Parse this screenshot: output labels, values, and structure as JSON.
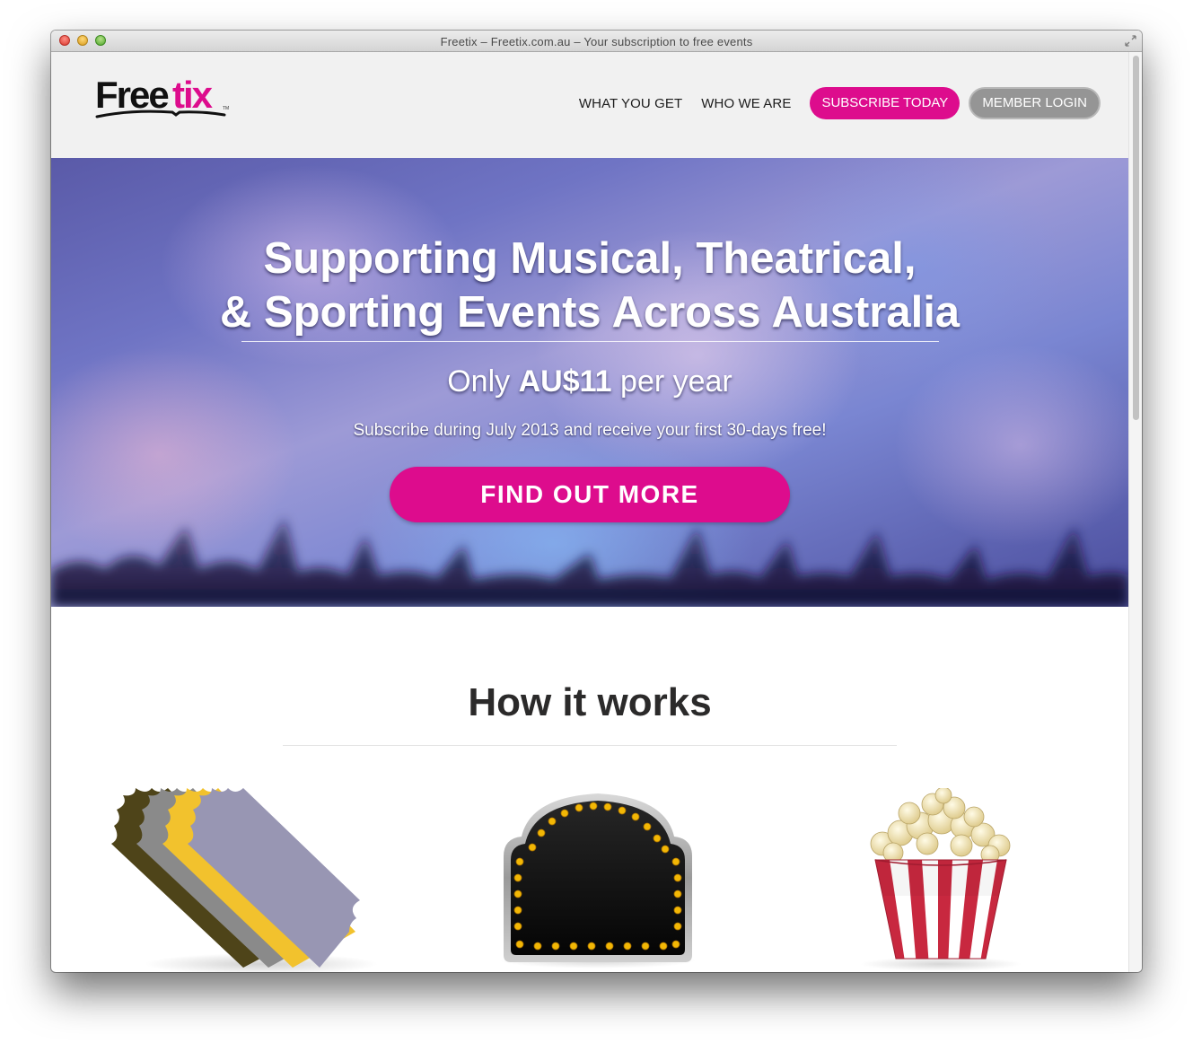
{
  "window": {
    "title": "Freetix – Freetix.com.au – Your subscription to free events"
  },
  "header": {
    "logo": {
      "brand_dark": "Free",
      "brand_accent": "tix",
      "trademark": "TM"
    },
    "nav": {
      "what_you_get": "WHAT YOU GET",
      "who_we_are": "WHO WE ARE",
      "subscribe": "SUBSCRIBE TODAY",
      "login": "MEMBER LOGIN"
    }
  },
  "hero": {
    "title_line1": "Supporting Musical, Theatrical,",
    "title_line2": "& Sporting Events Across Australia",
    "price_prefix": "Only",
    "price_amount": "AU$11",
    "price_suffix": "per year",
    "subtitle": "Subscribe during July 2013 and receive your first 30-days free!",
    "cta": "FIND OUT MORE"
  },
  "how_it_works": {
    "title": "How it works",
    "icons": [
      "tickets-icon",
      "marquee-sign-icon",
      "popcorn-icon"
    ]
  },
  "colors": {
    "accent": "#dd0c8d",
    "login_button": "#959595",
    "header_bg": "#f1f1f1",
    "text_dark": "#1c1c1c"
  }
}
